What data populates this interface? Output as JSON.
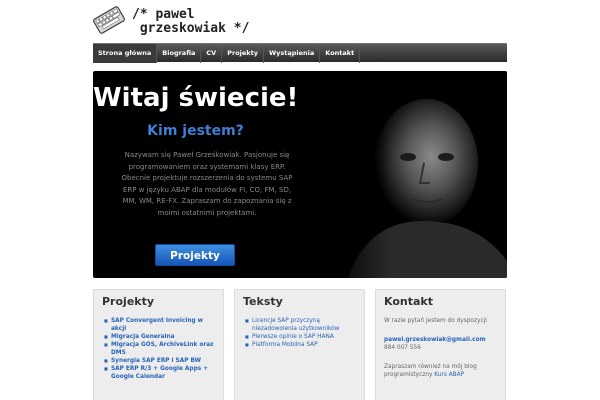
{
  "site": {
    "title": "/* pawel\n grzeskowiak */"
  },
  "nav": {
    "items": [
      "Strona główna",
      "Biografia",
      "CV",
      "Projekty",
      "Wystąpienia",
      "Kontakt"
    ]
  },
  "hero": {
    "title": "Witaj świecie!",
    "subtitle": "Kim jestem?",
    "text": "Nazywam się Paweł Grześkowiak. Pasjonuje się programowaniem oraz systemami klasy ERP. Obecnie projektuje rozszerzenia do systemu SAP ERP w języku ABAP dla modułów FI, CO, FM, SD, MM, WM, RE-FX. Zapraszam do zapoznania się z moimi ostatnimi projektami.",
    "button_label": "Projekty"
  },
  "projects": {
    "title": "Projekty",
    "items": [
      "SAP Convergent Invoicing w akcji",
      "Migracja Generalna",
      "Migracja GOS, ArchiveLink oraz DMS",
      "Synergia SAP ERP i SAP BW",
      "SAP ERP R/3 + Google Apps + Google Calendar"
    ]
  },
  "texts": {
    "title": "Teksty",
    "items": [
      "Licencje SAP przyczyną niezadowolenia użytkowników",
      "Pierwsze opinie o SAP HANA",
      "Platforma Mobilna SAP"
    ]
  },
  "contact": {
    "title": "Kontakt",
    "intro": "W razie pytań jestem do dyspozycji",
    "email": "pawel.grzeskowiak@gmail.com",
    "phone": "884 007 556",
    "blog_text": "Zapraszam również na mój blog programistyczny",
    "blog_link": "Kurs ABAP"
  },
  "colors": {
    "accent": "#3f7fd6",
    "link": "#2864b8",
    "nav_bg": "#3a3a3a"
  }
}
